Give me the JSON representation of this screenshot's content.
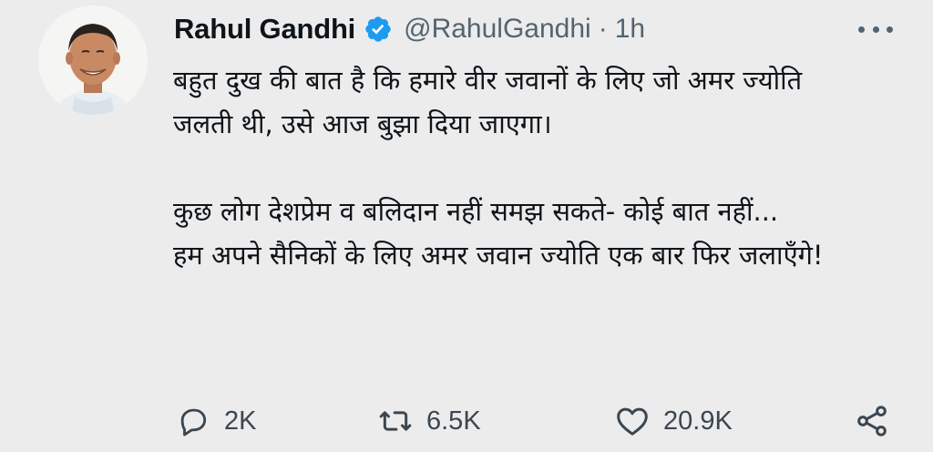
{
  "tweet": {
    "display_name": "Rahul Gandhi",
    "handle": "@RahulGandhi",
    "separator": "·",
    "time": "1h",
    "body": {
      "line1": "बहुत दुख की बात है कि हमारे वीर जवानों के लिए जो अमर ज्योति जलती थी, उसे आज बुझा दिया जाएगा।",
      "line2": "कुछ लोग देशप्रेम व बलिदान नहीं समझ सकते- कोई बात नहीं...",
      "line3": "हम अपने सैनिकों के लिए अमर जवान ज्योति एक बार फिर जलाएँगे!"
    },
    "actions": {
      "reply_icon": "speech-bubble-icon",
      "reply_count": "2K",
      "retweet_icon": "retweet-arrows-icon",
      "retweet_count": "6.5K",
      "like_icon": "heart-icon",
      "like_count": "20.9K",
      "share_icon": "share-nodes-icon"
    },
    "verified_icon": "verified-badge-icon",
    "more_icon": "more-dots-icon"
  },
  "colors": {
    "background": "#ececec",
    "text": "#0f1419",
    "secondary_text": "#536471",
    "verified_blue": "#1d9bf0"
  }
}
